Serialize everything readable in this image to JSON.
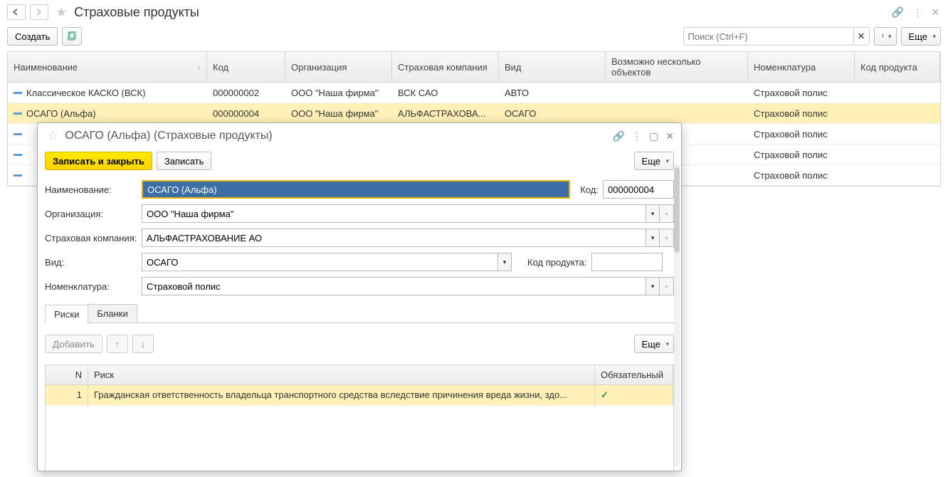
{
  "page": {
    "title": "Страховые продукты",
    "create_btn": "Создать",
    "search_placeholder": "Поиск (Ctrl+F)",
    "more_btn": "Еще"
  },
  "columns": {
    "name": "Наименование",
    "code": "Код",
    "org": "Организация",
    "ins": "Страховая компания",
    "type": "Вид",
    "multi": "Возможно несколько объектов",
    "nom": "Номенклатура",
    "prod": "Код продукта"
  },
  "rows": [
    {
      "name": "Классическое КАСКО (ВСК)",
      "code": "000000002",
      "org": "ООО \"Наша фирма\"",
      "ins": "ВСК САО",
      "type": "АВТО",
      "nom": "Страховой полис",
      "selected": false
    },
    {
      "name": "ОСАГО (Альфа)",
      "code": "000000004",
      "org": "ООО \"Наша фирма\"",
      "ins": "АЛЬФАСТРАХОВА...",
      "type": "ОСАГО",
      "nom": "Страховой полис",
      "selected": true
    },
    {
      "name": "",
      "code": "",
      "org": "",
      "ins": "",
      "type": "",
      "nom": "Страховой полис",
      "selected": false
    },
    {
      "name": "",
      "code": "",
      "org": "",
      "ins": "",
      "type": "",
      "nom": "Страховой полис",
      "selected": false
    },
    {
      "name": "",
      "code": "",
      "org": "",
      "ins": "",
      "type": "",
      "nom": "Страховой полис",
      "selected": false
    }
  ],
  "dialog": {
    "title": "ОСАГО (Альфа) (Страховые продукты)",
    "save_close": "Записать и закрыть",
    "save": "Записать",
    "more": "Еще",
    "labels": {
      "name": "Наименование:",
      "code": "Код:",
      "org": "Организация:",
      "ins": "Страховая компания:",
      "type": "Вид:",
      "prod": "Код продукта:",
      "nom": "Номенклатура:"
    },
    "values": {
      "name": "ОСАГО (Альфа)",
      "code": "000000004",
      "org": "ООО \"Наша фирма\"",
      "ins": "АЛЬФАСТРАХОВАНИЕ АО",
      "type": "ОСАГО",
      "prod": "",
      "nom": "Страховой полис"
    },
    "tabs": {
      "risks": "Риски",
      "blanks": "Бланки"
    },
    "sub": {
      "add": "Добавить",
      "more": "Еще"
    },
    "risk_cols": {
      "n": "N",
      "risk": "Риск",
      "req": "Обязательный"
    },
    "risk_rows": [
      {
        "n": "1",
        "risk": "Гражданская ответственность владельца транспортного средства вследствие причинения вреда жизни, здо...",
        "req": true
      }
    ]
  }
}
